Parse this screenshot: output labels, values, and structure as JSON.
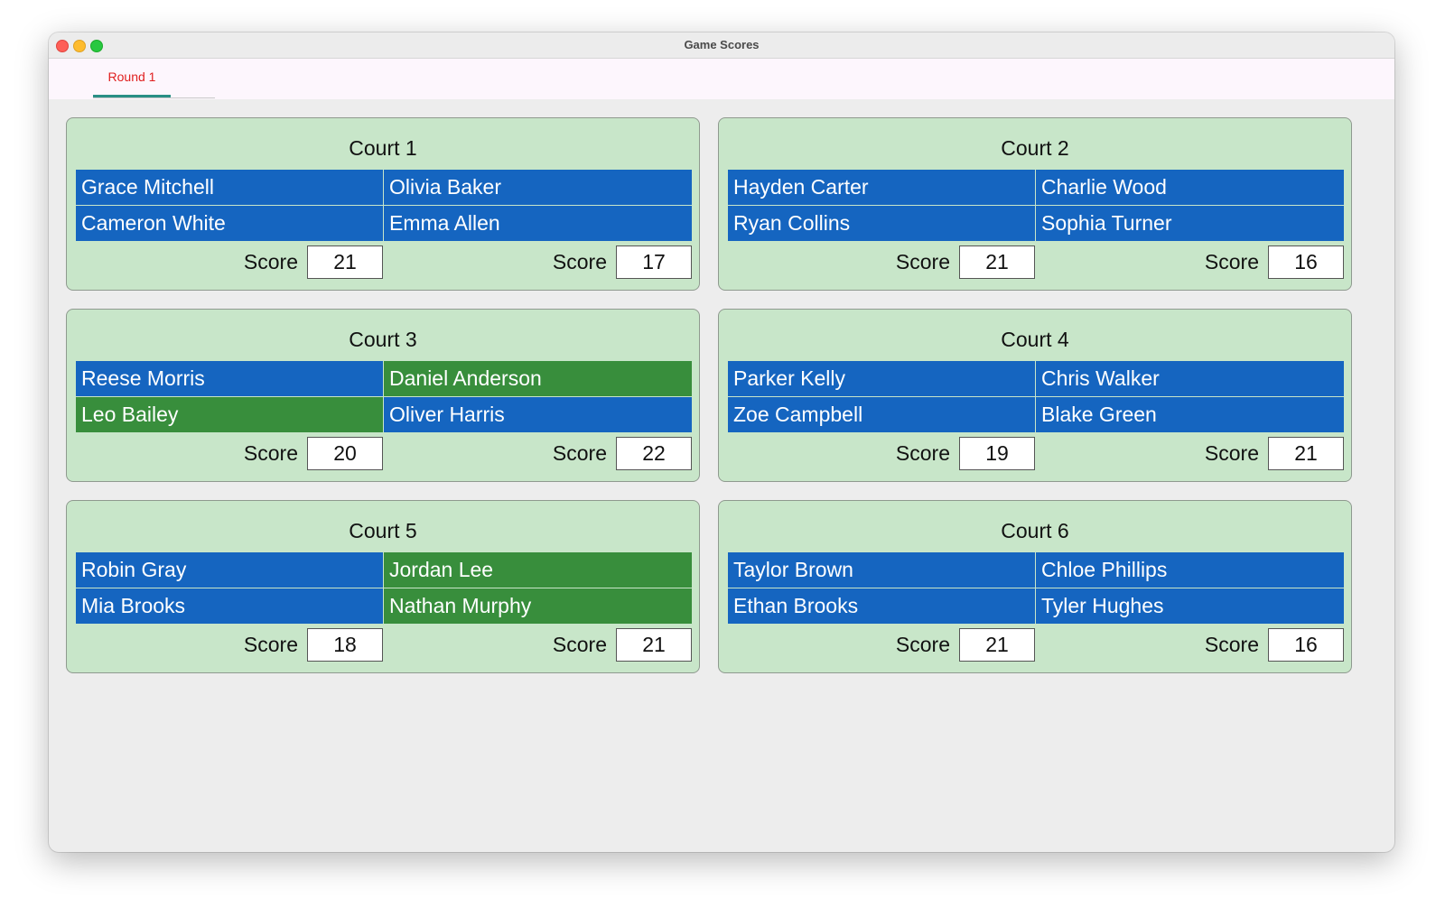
{
  "window": {
    "title": "Game Scores"
  },
  "tabs": [
    {
      "label": "Round 1",
      "active": true
    }
  ],
  "colors": {
    "player_blue": "#1565c0",
    "player_green": "#388e3c",
    "court_bg": "#c8e6c9",
    "active_tab": "#e02020",
    "tab_indicator": "#2a8f86"
  },
  "score_label": "Score",
  "courts": [
    {
      "title": "Court 1",
      "players": [
        {
          "name": "Grace Mitchell",
          "color": "blue"
        },
        {
          "name": "Olivia Baker",
          "color": "blue"
        },
        {
          "name": "Cameron White",
          "color": "blue"
        },
        {
          "name": "Emma Allen",
          "color": "blue"
        }
      ],
      "scores": [
        "21",
        "17"
      ]
    },
    {
      "title": "Court 2",
      "players": [
        {
          "name": "Hayden Carter",
          "color": "blue"
        },
        {
          "name": "Charlie Wood",
          "color": "blue"
        },
        {
          "name": "Ryan Collins",
          "color": "blue"
        },
        {
          "name": "Sophia Turner",
          "color": "blue"
        }
      ],
      "scores": [
        "21",
        "16"
      ]
    },
    {
      "title": "Court 3",
      "players": [
        {
          "name": "Reese Morris",
          "color": "blue"
        },
        {
          "name": "Daniel Anderson",
          "color": "green"
        },
        {
          "name": "Leo Bailey",
          "color": "green"
        },
        {
          "name": "Oliver Harris",
          "color": "blue"
        }
      ],
      "scores": [
        "20",
        "22"
      ]
    },
    {
      "title": "Court 4",
      "players": [
        {
          "name": "Parker Kelly",
          "color": "blue"
        },
        {
          "name": "Chris Walker",
          "color": "blue"
        },
        {
          "name": "Zoe Campbell",
          "color": "blue"
        },
        {
          "name": "Blake Green",
          "color": "blue"
        }
      ],
      "scores": [
        "19",
        "21"
      ]
    },
    {
      "title": "Court 5",
      "players": [
        {
          "name": "Robin Gray",
          "color": "blue"
        },
        {
          "name": "Jordan Lee",
          "color": "green"
        },
        {
          "name": "Mia Brooks",
          "color": "blue"
        },
        {
          "name": "Nathan Murphy",
          "color": "green"
        }
      ],
      "scores": [
        "18",
        "21"
      ]
    },
    {
      "title": "Court 6",
      "players": [
        {
          "name": "Taylor Brown",
          "color": "blue"
        },
        {
          "name": "Chloe Phillips",
          "color": "blue"
        },
        {
          "name": "Ethan Brooks",
          "color": "blue"
        },
        {
          "name": "Tyler Hughes",
          "color": "blue"
        }
      ],
      "scores": [
        "21",
        "16"
      ]
    }
  ]
}
